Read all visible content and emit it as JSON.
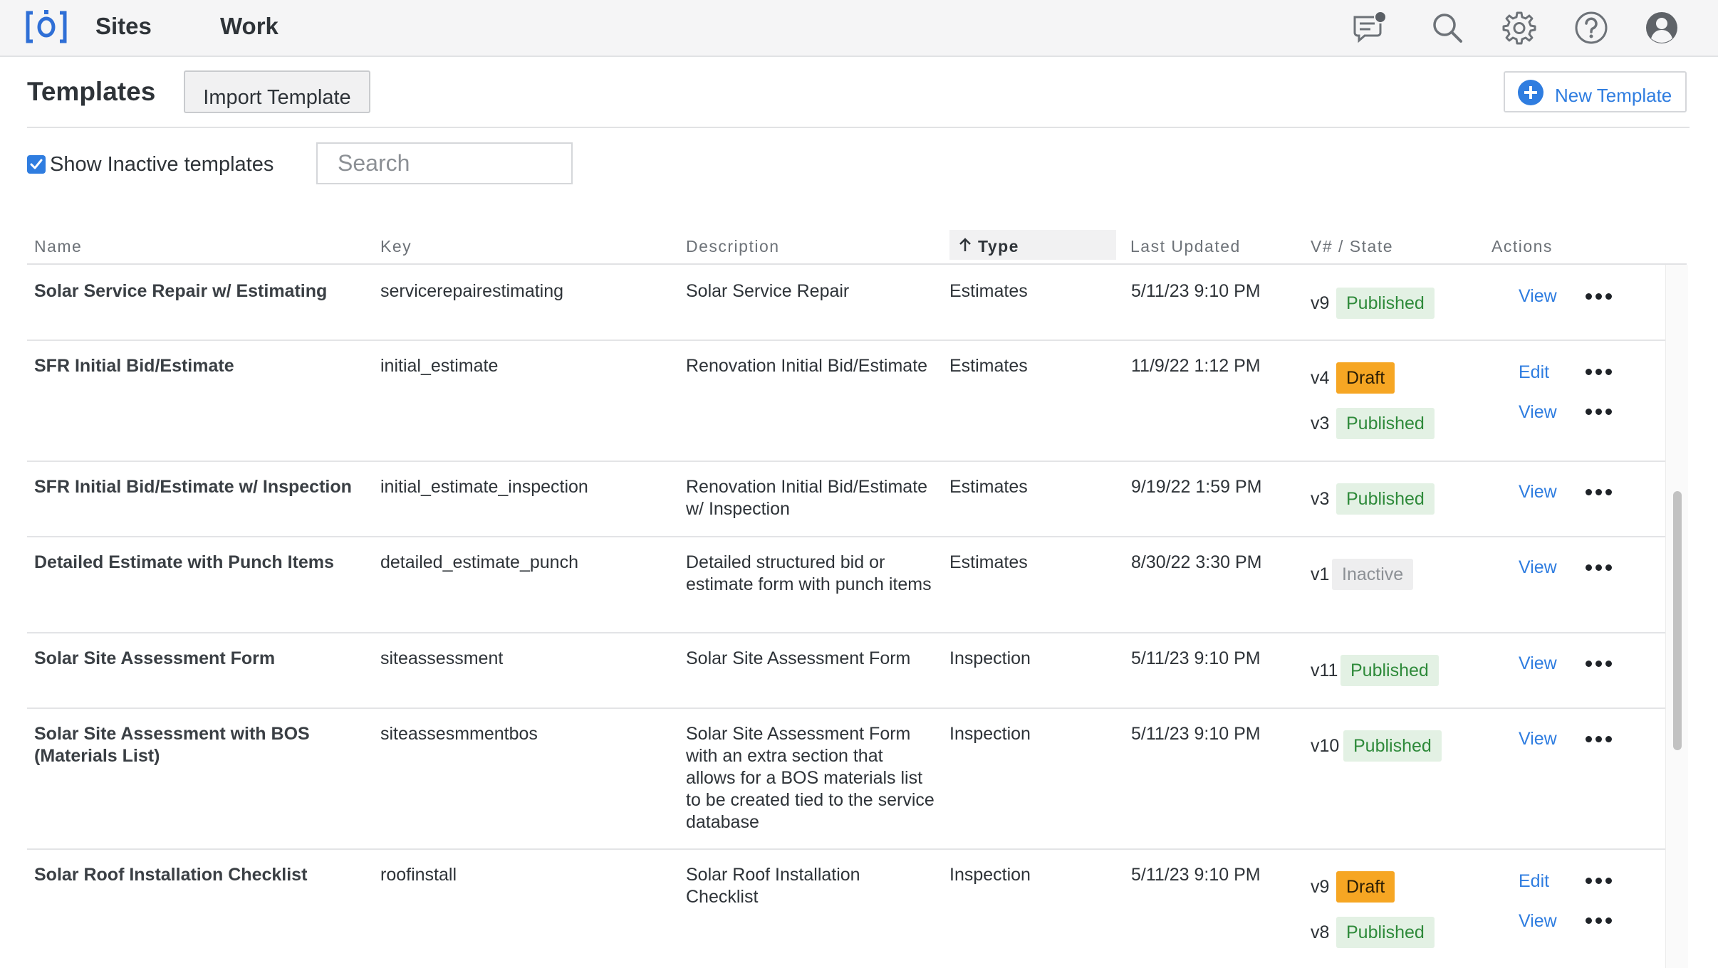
{
  "nav": {
    "links": [
      "Sites",
      "Work"
    ],
    "icons": [
      "chat-notification-icon",
      "search-icon",
      "gear-icon",
      "help-icon",
      "user-avatar-icon"
    ]
  },
  "header": {
    "title": "Templates",
    "import_label": "Import Template",
    "new_label": "New Template"
  },
  "filters": {
    "show_inactive_label": "Show Inactive templates",
    "show_inactive_checked": true,
    "search_placeholder": "Search",
    "search_value": ""
  },
  "table": {
    "columns": [
      "Name",
      "Key",
      "Description",
      "Type",
      "Last Updated",
      "V# / State",
      "Actions"
    ],
    "sort": {
      "column": "Type",
      "direction": "ascending"
    },
    "rows": [
      {
        "name": "Solar Service Repair w/ Estimating",
        "key": "servicerepairestimating",
        "description": "Solar Service Repair",
        "type": "Estimates",
        "updated": "5/11/23 9:10 PM",
        "versions": [
          {
            "v": "v9",
            "state": "Published",
            "action": "View"
          }
        ]
      },
      {
        "name": "SFR Initial Bid/Estimate",
        "key": "initial_estimate",
        "description": "Renovation Initial Bid/Estimate",
        "type": "Estimates",
        "updated": "11/9/22 1:12 PM",
        "versions": [
          {
            "v": "v4",
            "state": "Draft",
            "action": "Edit"
          },
          {
            "v": "v3",
            "state": "Published",
            "action": "View"
          }
        ]
      },
      {
        "name": "SFR Initial Bid/Estimate w/ Inspection",
        "key": "initial_estimate_inspection",
        "description": "Renovation Initial Bid/Estimate w/ Inspection",
        "type": "Estimates",
        "updated": "9/19/22 1:59 PM",
        "versions": [
          {
            "v": "v3",
            "state": "Published",
            "action": "View"
          }
        ]
      },
      {
        "name": "Detailed Estimate with Punch Items",
        "key": "detailed_estimate_punch",
        "description": "Detailed structured bid or estimate form with punch items",
        "type": "Estimates",
        "updated": "8/30/22 3:30 PM",
        "versions": [
          {
            "v": "v1",
            "state": "Inactive",
            "action": "View"
          }
        ]
      },
      {
        "name": "Solar Site Assessment Form",
        "key": "siteassessment",
        "description": "Solar Site Assessment Form",
        "type": "Inspection",
        "updated": "5/11/23 9:10 PM",
        "versions": [
          {
            "v": "v11",
            "state": "Published",
            "action": "View"
          }
        ]
      },
      {
        "name": "Solar Site Assessment with BOS (Materials List)",
        "key": "siteassesmmentbos",
        "description": "Solar Site Assessment Form with an extra section that allows for a BOS materials list to be created tied to the service database",
        "type": "Inspection",
        "updated": "5/11/23 9:10 PM",
        "versions": [
          {
            "v": "v10",
            "state": "Published",
            "action": "View"
          }
        ]
      },
      {
        "name": "Solar Roof Installation Checklist",
        "key": "roofinstall",
        "description": "Solar Roof Installation Checklist",
        "type": "Inspection",
        "updated": "5/11/23 9:10 PM",
        "versions": [
          {
            "v": "v9",
            "state": "Draft",
            "action": "Edit"
          },
          {
            "v": "v8",
            "state": "Published",
            "action": "View"
          }
        ]
      }
    ]
  },
  "colors": {
    "accent": "#2f7de0",
    "published_bg": "#e3f1e4",
    "published_text": "#2e8a3a",
    "draft_bg": "#f6a623",
    "inactive_bg": "#eeeeef"
  }
}
